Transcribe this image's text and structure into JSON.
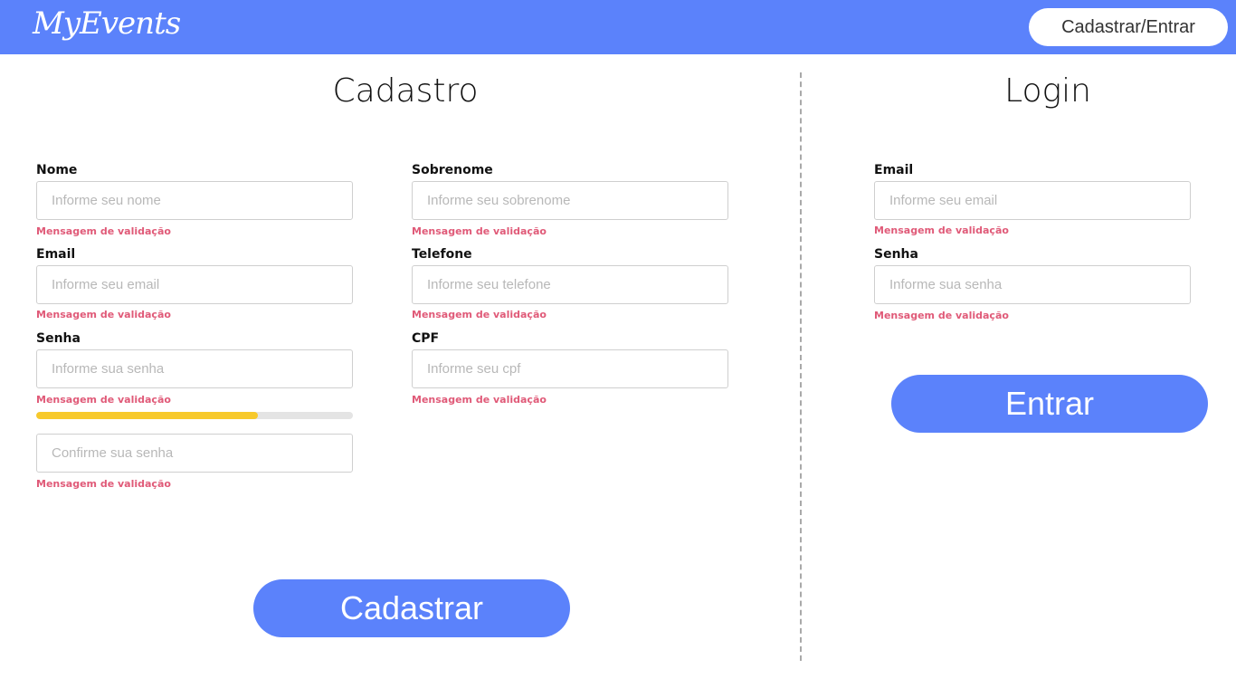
{
  "header": {
    "logo": "MyEvents",
    "nav_button": "Cadastrar/Entrar"
  },
  "register": {
    "title": "Cadastro",
    "fields": {
      "nome": {
        "label": "Nome",
        "placeholder": "Informe seu nome",
        "validation": "Mensagem de validação"
      },
      "sobrenome": {
        "label": "Sobrenome",
        "placeholder": "Informe seu sobrenome",
        "validation": "Mensagem de validação"
      },
      "email": {
        "label": "Email",
        "placeholder": "Informe seu email",
        "validation": "Mensagem de validação"
      },
      "telefone": {
        "label": "Telefone",
        "placeholder": "Informe seu telefone",
        "validation": "Mensagem de validação"
      },
      "senha": {
        "label": "Senha",
        "placeholder": "Informe sua senha",
        "validation": "Mensagem de validação"
      },
      "cpf": {
        "label": "CPF",
        "placeholder": "Informe seu cpf",
        "validation": "Mensagem de validação"
      },
      "confirm": {
        "placeholder": "Confirme sua senha",
        "validation": "Mensagem de validação"
      }
    },
    "password_strength": {
      "fraction": 0.7,
      "color": "#f7c92b"
    },
    "submit": "Cadastrar"
  },
  "login": {
    "title": "Login",
    "fields": {
      "email": {
        "label": "Email",
        "placeholder": "Informe seu email",
        "validation": "Mensagem de validação"
      },
      "senha": {
        "label": "Senha",
        "placeholder": "Informe sua senha",
        "validation": "Mensagem de validação"
      }
    },
    "submit": "Entrar"
  },
  "colors": {
    "brand": "#5b82fb",
    "validation": "#e05a78"
  }
}
